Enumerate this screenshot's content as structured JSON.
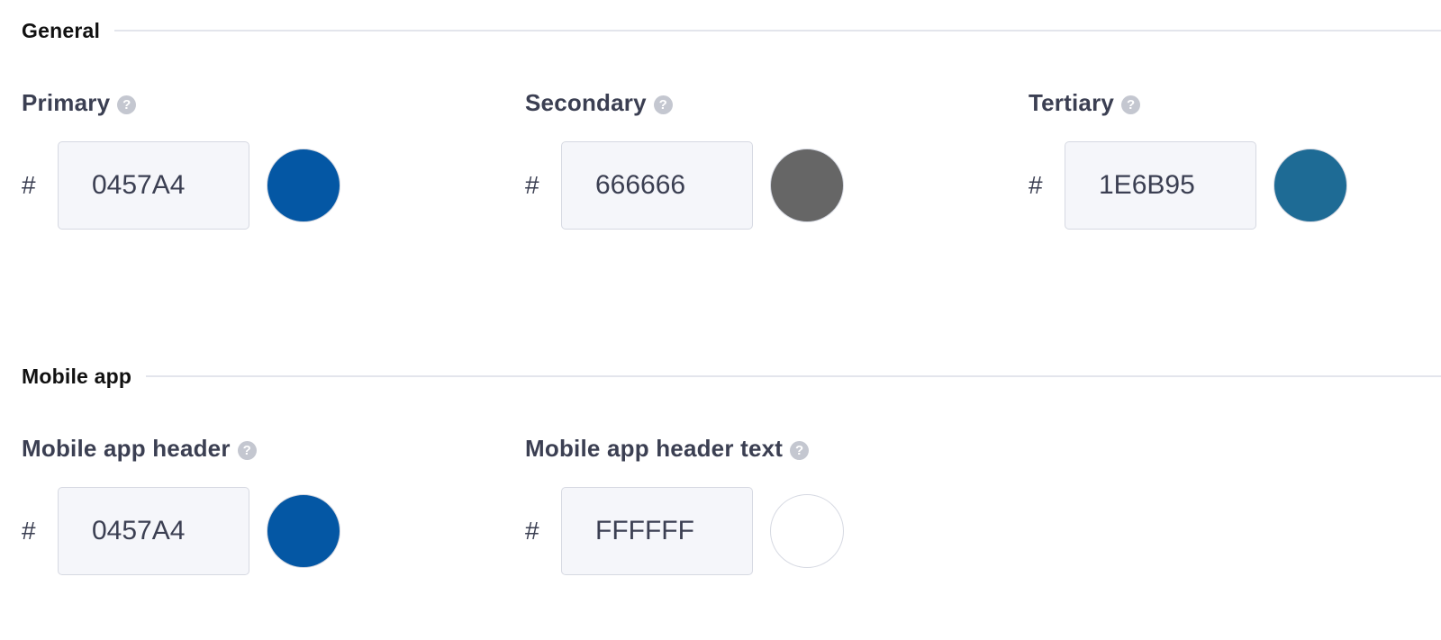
{
  "sections": {
    "general": {
      "title": "General",
      "fields": [
        {
          "label": "Primary",
          "help_icon": "question-circle-icon",
          "prefix": "#",
          "value": "0457A4",
          "color": "#0457A4"
        },
        {
          "label": "Secondary",
          "help_icon": "question-circle-icon",
          "prefix": "#",
          "value": "666666",
          "color": "#666666"
        },
        {
          "label": "Tertiary",
          "help_icon": "question-circle-icon",
          "prefix": "#",
          "value": "1E6B95",
          "color": "#1E6B95"
        }
      ]
    },
    "mobile_app": {
      "title": "Mobile app",
      "fields": [
        {
          "label": "Mobile app header",
          "help_icon": "question-circle-icon",
          "prefix": "#",
          "value": "0457A4",
          "color": "#0457A4"
        },
        {
          "label": "Mobile app header text",
          "help_icon": "question-circle-icon",
          "prefix": "#",
          "value": "FFFFFF",
          "color": "#FFFFFF"
        }
      ]
    }
  },
  "help_glyph": "?",
  "colors": {
    "text": "#3b3f52",
    "heading": "#111111",
    "input_bg": "#f5f6fa",
    "border": "#d6d9e2",
    "help_icon": "#c4c7d0"
  }
}
